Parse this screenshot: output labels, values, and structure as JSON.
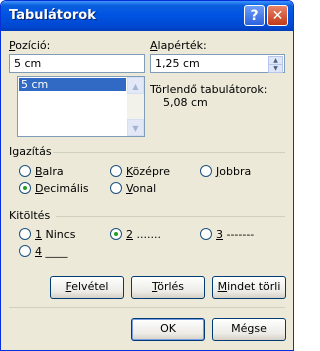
{
  "window": {
    "title": "Tabulátorok"
  },
  "titlebar_buttons": {
    "help": "?",
    "close": "✕"
  },
  "position": {
    "label_pre": "",
    "label_key": "P",
    "label_post": "ozíció:",
    "value": "5 cm",
    "list_items": [
      "5 cm"
    ]
  },
  "default_tab": {
    "label_pre": "",
    "label_key": "A",
    "label_post": "lapérték:",
    "value": "1,25 cm"
  },
  "to_clear": {
    "label": "Törlendő tabulátorok:",
    "value": "5,08 cm"
  },
  "alignment": {
    "title": "Igazítás",
    "options": [
      {
        "pre": "",
        "key": "B",
        "post": "alra",
        "selected": false
      },
      {
        "pre": "",
        "key": "K",
        "post": "özépre",
        "selected": false
      },
      {
        "pre": "",
        "key": "J",
        "post": "obbra",
        "selected": false
      },
      {
        "pre": "",
        "key": "D",
        "post": "ecimális",
        "selected": true
      },
      {
        "pre": "",
        "key": "V",
        "post": "onal",
        "selected": false
      }
    ]
  },
  "leader": {
    "title": "Kitöltés",
    "options": [
      {
        "pre": "",
        "key": "1",
        "post": " Nincs",
        "selected": false
      },
      {
        "pre": "",
        "key": "2",
        "post": " .......",
        "selected": true
      },
      {
        "pre": "",
        "key": "3",
        "post": " -------",
        "selected": false
      },
      {
        "pre": "",
        "key": "4",
        "post": " ____",
        "selected": false
      }
    ]
  },
  "buttons": {
    "set": {
      "pre": "",
      "key": "F",
      "post": "elvétel"
    },
    "clear": {
      "pre": "",
      "key": "T",
      "post": "örlés"
    },
    "clear_all": {
      "pre": "",
      "key": "M",
      "post": "indet törli"
    },
    "ok": "OK",
    "cancel": "Mégse"
  },
  "colors": {
    "titlebar": "#0054e3",
    "selection": "#316ac5",
    "radio_dot": "#21a121"
  }
}
